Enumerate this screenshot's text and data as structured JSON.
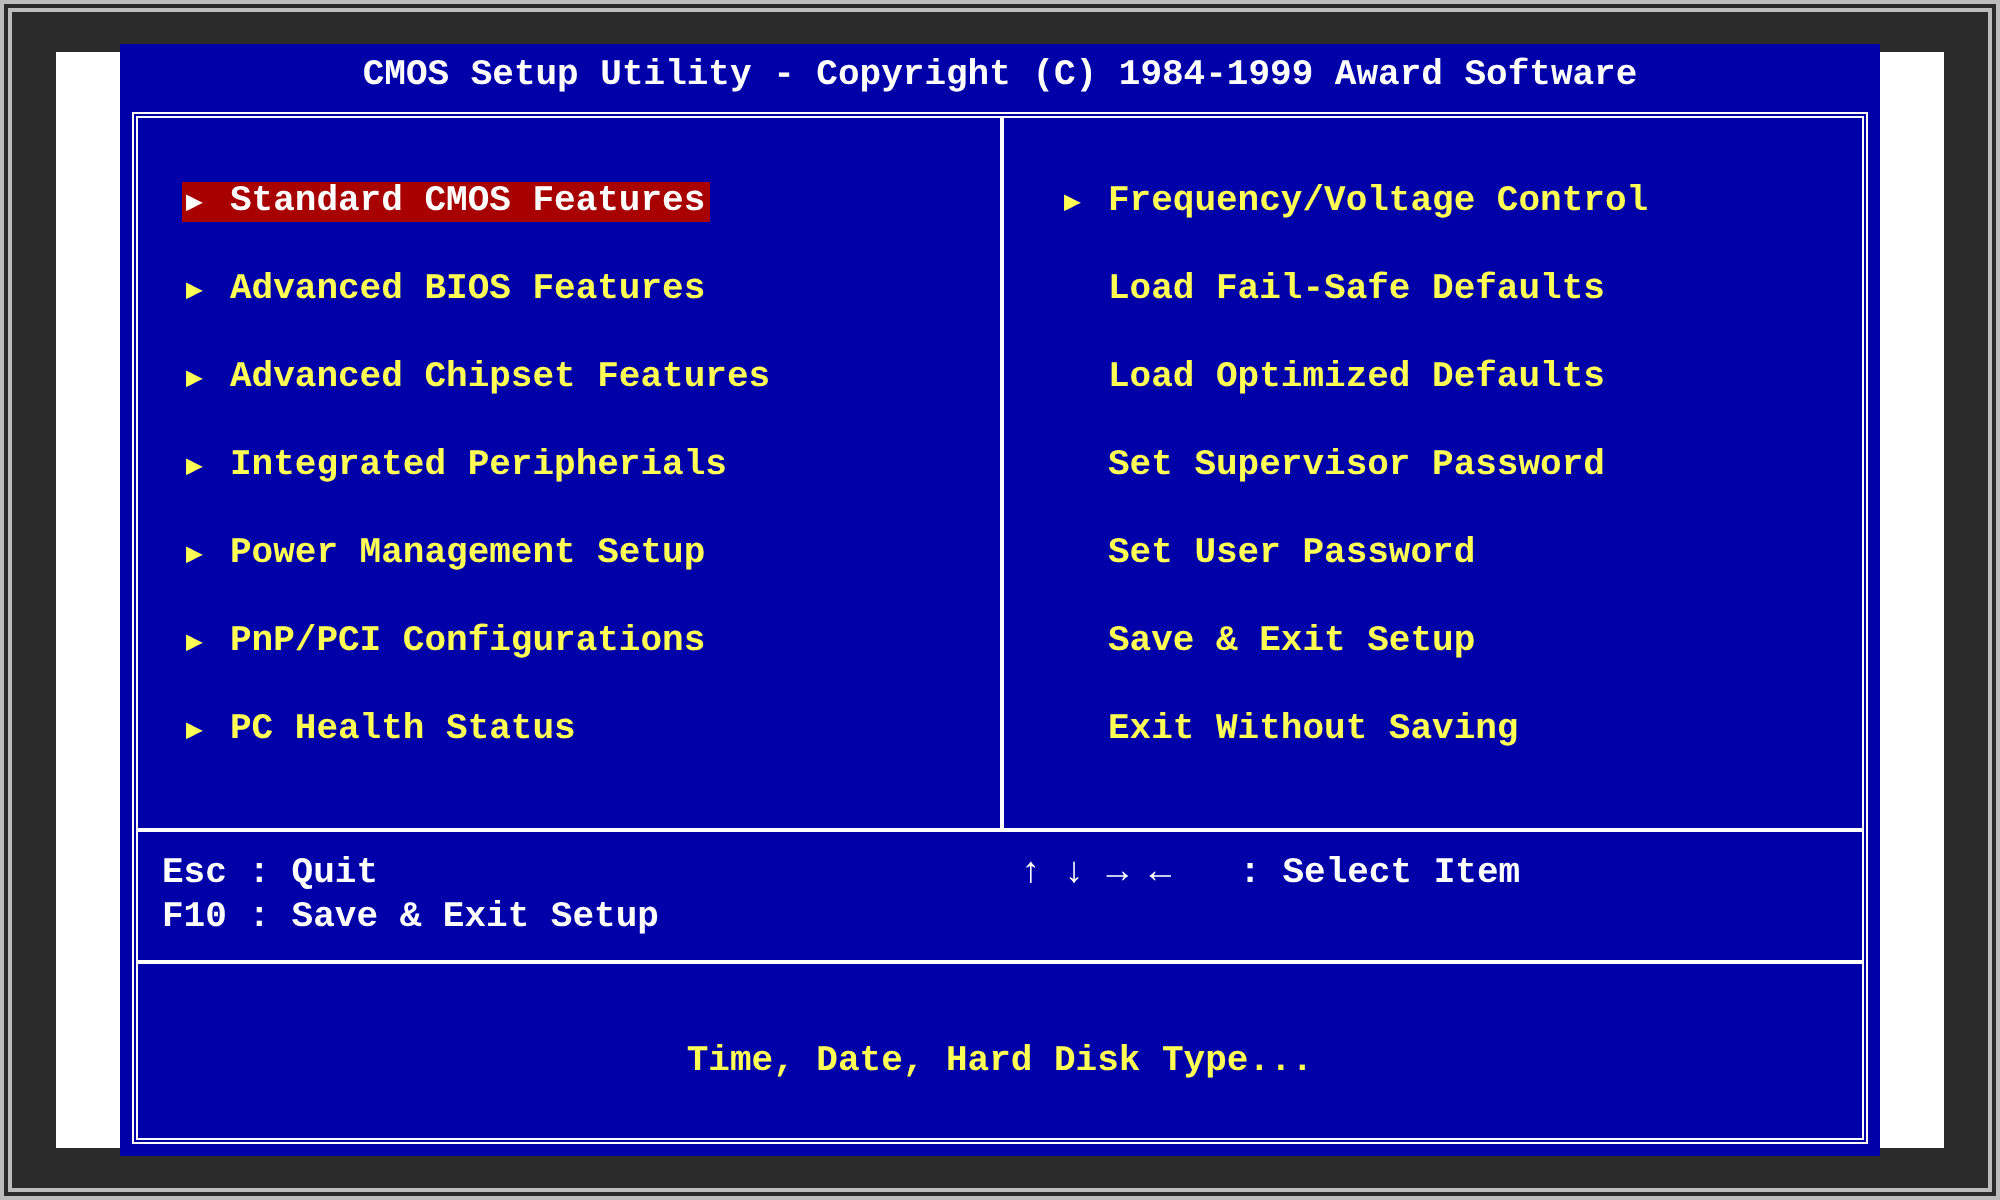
{
  "title": "CMOS Setup Utility - Copyright (C) 1984-1999 Award Software",
  "menu": {
    "left": [
      {
        "marker": "▶",
        "label": "Standard CMOS Features",
        "selected": true
      },
      {
        "marker": "▶",
        "label": "Advanced BIOS Features",
        "selected": false
      },
      {
        "marker": "▶",
        "label": "Advanced Chipset Features",
        "selected": false
      },
      {
        "marker": "▶",
        "label": "Integrated Peripherials",
        "selected": false
      },
      {
        "marker": "▶",
        "label": "Power Management Setup",
        "selected": false
      },
      {
        "marker": "▶",
        "label": "PnP/PCI Configurations",
        "selected": false
      },
      {
        "marker": "▶",
        "label": "PC Health Status",
        "selected": false
      }
    ],
    "right": [
      {
        "marker": "▶",
        "label": "Frequency/Voltage Control",
        "selected": false
      },
      {
        "label": "Load Fail-Safe Defaults",
        "selected": false
      },
      {
        "label": "Load Optimized Defaults",
        "selected": false
      },
      {
        "label": "Set Supervisor Password",
        "selected": false
      },
      {
        "label": "Set User Password",
        "selected": false
      },
      {
        "label": "Save & Exit Setup",
        "selected": false
      },
      {
        "label": "Exit Without Saving",
        "selected": false
      }
    ]
  },
  "key_help": {
    "left": [
      "Esc : Quit",
      "F10 : Save & Exit Setup"
    ],
    "arrows": "↑ ↓ → ←",
    "right": ": Select Item"
  },
  "description": "Time, Date, Hard Disk Type..."
}
